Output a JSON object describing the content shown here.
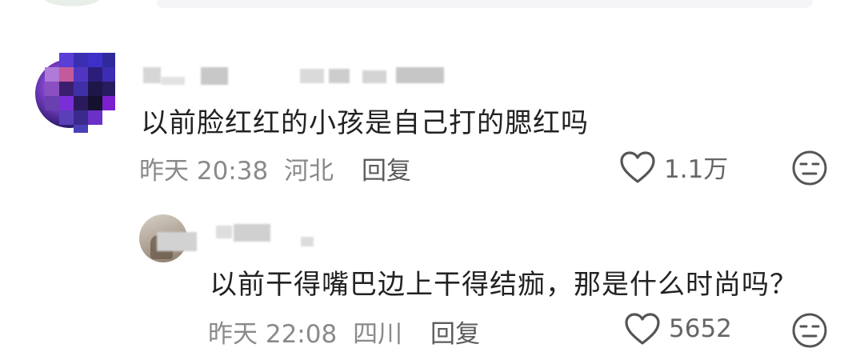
{
  "comments": [
    {
      "text": "以前脸红红的小孩是自己打的腮红吗",
      "time": "昨天 20:38",
      "location": "河北",
      "reply_label": "回复",
      "likes": "1.1万",
      "like_icon": "heart-outline-icon",
      "dislike_icon": "meh-face-icon"
    },
    {
      "text": "以前干得嘴巴边上干得结痂，那是什么时尚吗？",
      "time": "昨天 22:08",
      "location": "四川",
      "reply_label": "回复",
      "likes": "5652",
      "like_icon": "heart-outline-icon",
      "dislike_icon": "meh-face-icon"
    }
  ],
  "colors": {
    "text": "#222222",
    "meta": "#8a8a8a",
    "icon": "#555555",
    "background": "#ffffff"
  }
}
